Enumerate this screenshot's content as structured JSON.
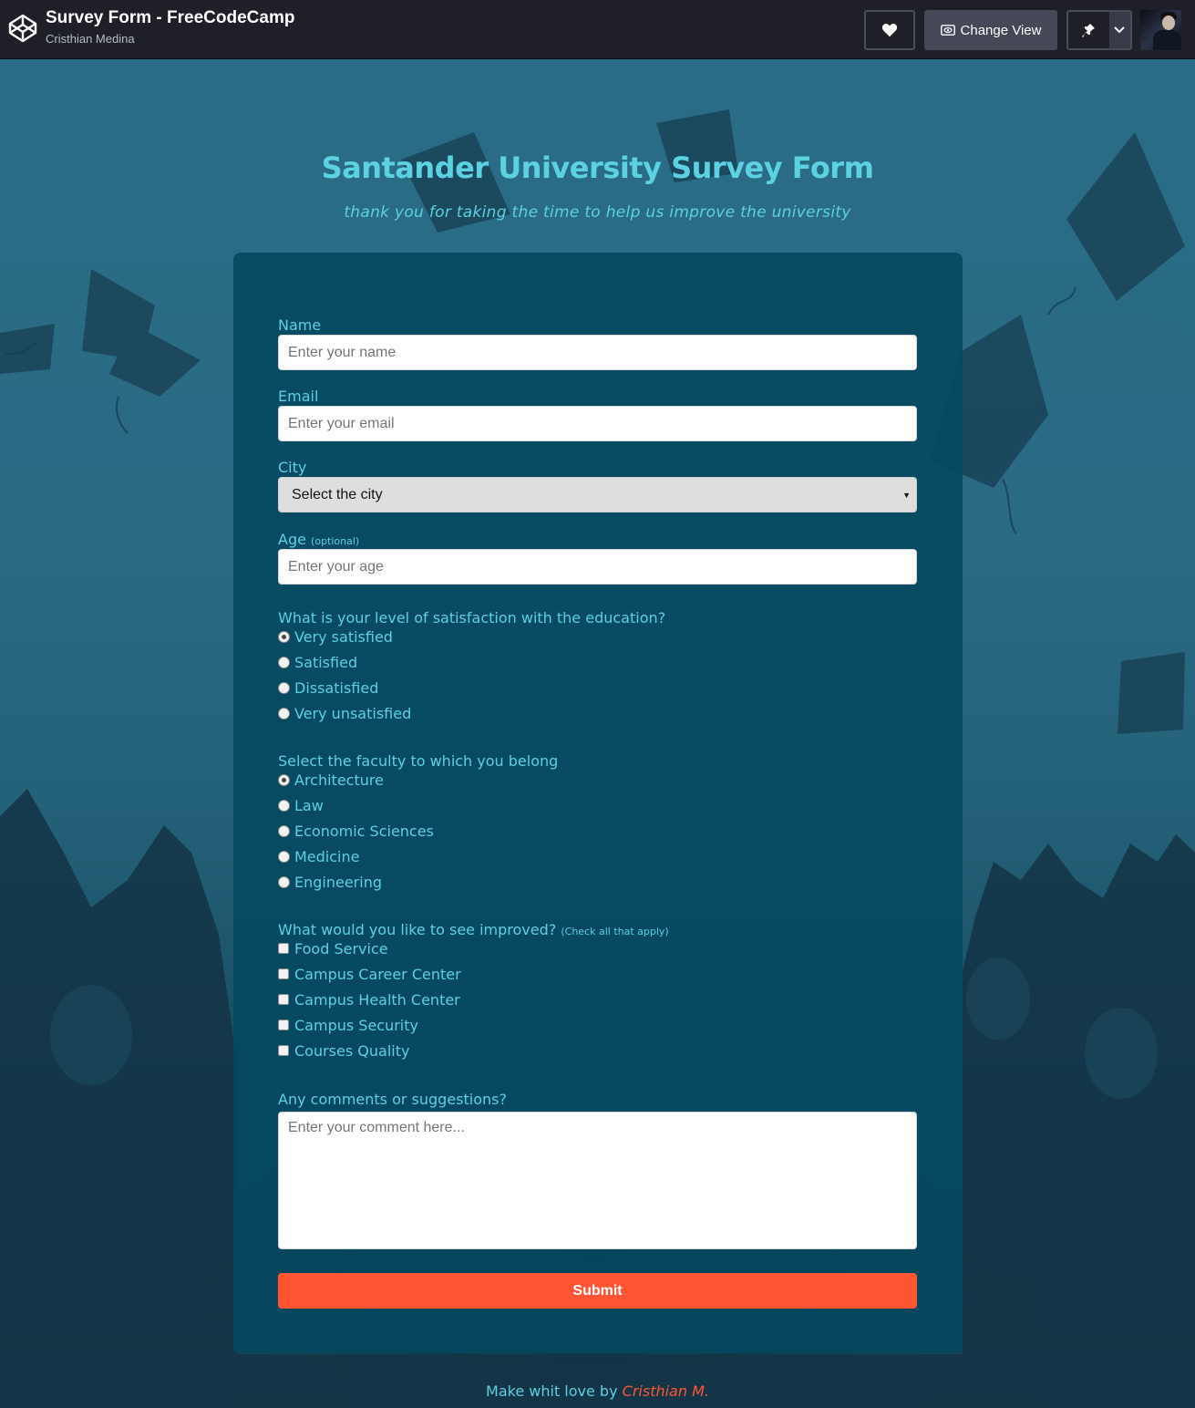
{
  "header": {
    "title": "Survey Form - FreeCodeCamp",
    "author": "Cristhian Medina",
    "logo_icon": "codepen-logo-icon",
    "heart_icon": "heart-icon",
    "change_view_label": "Change View",
    "change_view_icon": "eye-icon",
    "pin_icon": "pin-icon",
    "dropdown_icon": "chevron-down-icon"
  },
  "page": {
    "title": "Santander University Survey Form",
    "subtitle": "thank you for taking the time to help us improve the university"
  },
  "form": {
    "name": {
      "label": "Name",
      "placeholder": "Enter your name"
    },
    "email": {
      "label": "Email",
      "placeholder": "Enter your email"
    },
    "city": {
      "label": "City",
      "selected": "Select the city"
    },
    "age": {
      "label": "Age",
      "hint": "(optional)",
      "placeholder": "Enter your age"
    },
    "satisfaction": {
      "question": "What is your level of satisfaction with the education?",
      "options": [
        "Very satisfied",
        "Satisfied",
        "Dissatisfied",
        "Very unsatisfied"
      ],
      "selected": "Very satisfied"
    },
    "faculty": {
      "question": "Select the faculty to which you belong",
      "options": [
        "Architecture",
        "Law",
        "Economic Sciences",
        "Medicine",
        "Engineering"
      ],
      "selected": "Architecture"
    },
    "improvements": {
      "question": "What would you like to see improved?",
      "hint": "(Check all that apply)",
      "options": [
        "Food Service",
        "Campus Career Center",
        "Campus Health Center",
        "Campus Security",
        "Courses Quality"
      ]
    },
    "comments": {
      "label": "Any comments or suggestions?",
      "placeholder": "Enter your comment here..."
    },
    "submit_label": "Submit"
  },
  "footer": {
    "text": "Make whit love by",
    "author": "Cristhian M."
  },
  "colors": {
    "accent": "#5bd1e2",
    "submit": "#ff5533",
    "card": "#04485f",
    "topbar": "#1f2027"
  }
}
